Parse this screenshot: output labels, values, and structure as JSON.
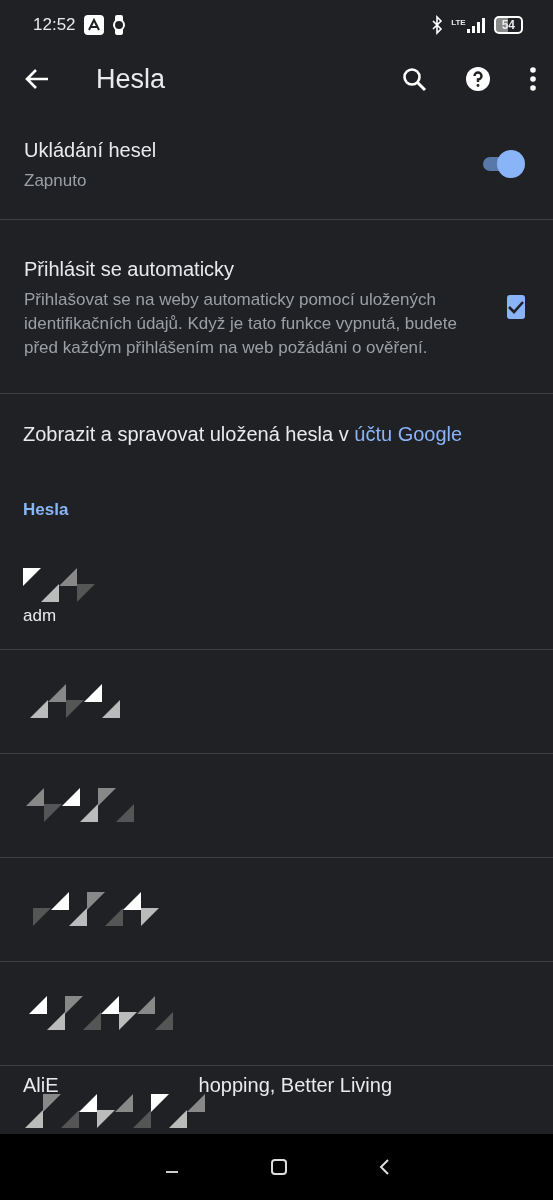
{
  "status_bar": {
    "time": "12:52",
    "network": "LTE",
    "battery": "54"
  },
  "app_bar": {
    "title": "Hesla"
  },
  "settings": [
    {
      "kind": "switch",
      "title": "Ukládání hesel",
      "subtitle": "Zapnuto",
      "on": true
    },
    {
      "kind": "checkbox",
      "title": "Přihlásit se automaticky",
      "subtitle": "Přihlašovat se na weby automaticky pomocí uložených identifikačních údajů. Když je tato funkce vypnutá, budete před každým přihlášením na web požádáni o ověření.",
      "checked": true
    }
  ],
  "account_link": {
    "text": "Zobrazit a spravovat uložená hesla v",
    "link": "účtu Google"
  },
  "section_header": "Hesla",
  "passwords": [
    {
      "kind": "redacted",
      "username": "adm"
    },
    {
      "kind": "redacted"
    },
    {
      "kind": "redacted"
    },
    {
      "kind": "redacted"
    },
    {
      "kind": "redacted"
    },
    {
      "kind": "redacted",
      "title_parts": [
        "AliE",
        "hopping, Better Living"
      ]
    }
  ]
}
